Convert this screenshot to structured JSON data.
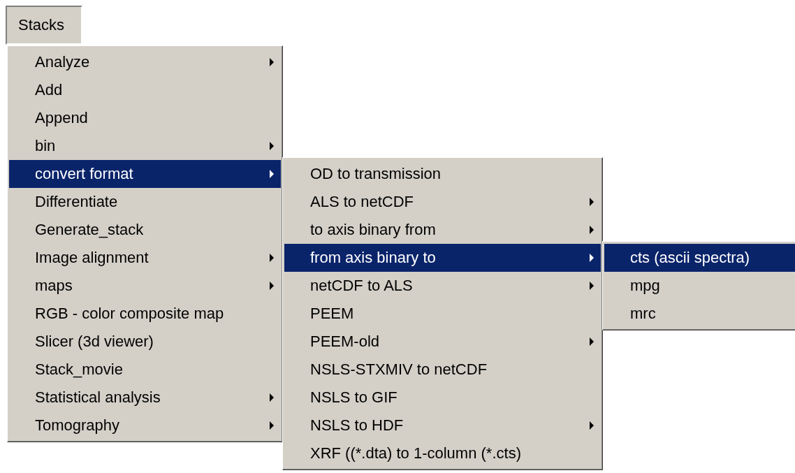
{
  "menubar": [
    {
      "label": "Stacks",
      "selected": true
    }
  ],
  "menu": {
    "items": [
      {
        "label": "Analyze",
        "submenu": true,
        "selected": false
      },
      {
        "label": "Add",
        "submenu": false,
        "selected": false
      },
      {
        "label": "Append",
        "submenu": false,
        "selected": false
      },
      {
        "label": "bin",
        "submenu": true,
        "selected": false
      },
      {
        "label": "convert format",
        "submenu": true,
        "selected": true,
        "children": [
          {
            "label": "OD to transmission",
            "submenu": false,
            "selected": false
          },
          {
            "label": "ALS to netCDF",
            "submenu": true,
            "selected": false
          },
          {
            "label": "to axis binary from",
            "submenu": true,
            "selected": false
          },
          {
            "label": "from axis binary to",
            "submenu": true,
            "selected": true,
            "children": [
              {
                "label": "cts (ascii spectra)",
                "submenu": false,
                "selected": true
              },
              {
                "label": "mpg",
                "submenu": false,
                "selected": false
              },
              {
                "label": "mrc",
                "submenu": false,
                "selected": false
              }
            ]
          },
          {
            "label": "netCDF to ALS",
            "submenu": true,
            "selected": false
          },
          {
            "label": "PEEM",
            "submenu": false,
            "selected": false
          },
          {
            "label": "PEEM-old",
            "submenu": true,
            "selected": false
          },
          {
            "label": "NSLS-STXMIV to netCDF",
            "submenu": false,
            "selected": false
          },
          {
            "label": "NSLS to GIF",
            "submenu": false,
            "selected": false
          },
          {
            "label": "NSLS to HDF",
            "submenu": true,
            "selected": false
          },
          {
            "label": "XRF ((*.dta) to 1-column (*.cts)",
            "submenu": false,
            "selected": false
          }
        ]
      },
      {
        "label": "Differentiate",
        "submenu": false,
        "selected": false
      },
      {
        "label": "Generate_stack",
        "submenu": false,
        "selected": false
      },
      {
        "label": "Image alignment",
        "submenu": true,
        "selected": false
      },
      {
        "label": "maps",
        "submenu": true,
        "selected": false
      },
      {
        "label": "RGB - color composite map",
        "submenu": false,
        "selected": false
      },
      {
        "label": "Slicer (3d viewer)",
        "submenu": false,
        "selected": false
      },
      {
        "label": "Stack_movie",
        "submenu": false,
        "selected": false
      },
      {
        "label": "Statistical analysis",
        "submenu": true,
        "selected": false
      },
      {
        "label": "Tomography",
        "submenu": true,
        "selected": false
      }
    ]
  }
}
